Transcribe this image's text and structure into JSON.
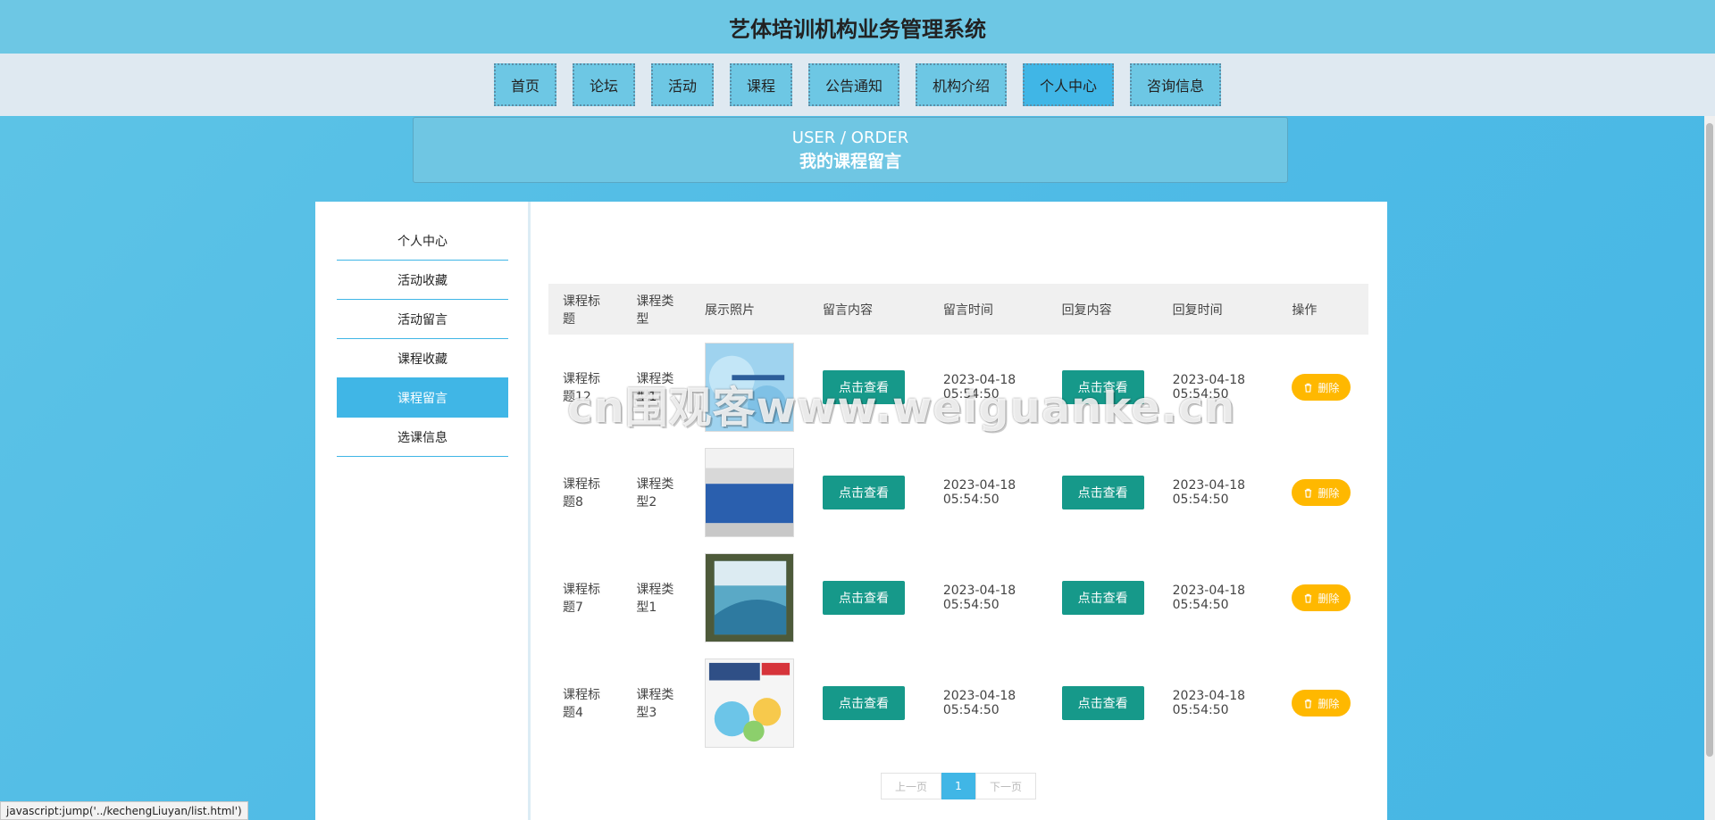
{
  "app_title": "艺体培训机构业务管理系统",
  "nav": [
    {
      "label": "首页"
    },
    {
      "label": "论坛"
    },
    {
      "label": "活动"
    },
    {
      "label": "课程"
    },
    {
      "label": "公告通知"
    },
    {
      "label": "机构介绍"
    },
    {
      "label": "个人中心",
      "active": true
    },
    {
      "label": "咨询信息"
    }
  ],
  "banner": {
    "en": "USER / ORDER",
    "zh": "我的课程留言"
  },
  "sidebar": {
    "items": [
      {
        "label": "个人中心"
      },
      {
        "label": "活动收藏"
      },
      {
        "label": "活动留言"
      },
      {
        "label": "课程收藏"
      },
      {
        "label": "课程留言",
        "active": true
      },
      {
        "label": "选课信息"
      }
    ]
  },
  "table": {
    "headers": [
      "课程标题",
      "课程类型",
      "展示照片",
      "留言内容",
      "留言时间",
      "回复内容",
      "回复时间",
      "操作"
    ],
    "rows": [
      {
        "title": "课程标题12",
        "type": "课程类型1",
        "content_btn": "点击查看",
        "time": "2023-04-18 05:54:50",
        "reply_btn": "点击查看",
        "reply_time": "2023-04-18 05:54:50",
        "delete": "删除"
      },
      {
        "title": "课程标题8",
        "type": "课程类型2",
        "content_btn": "点击查看",
        "time": "2023-04-18 05:54:50",
        "reply_btn": "点击查看",
        "reply_time": "2023-04-18 05:54:50",
        "delete": "删除"
      },
      {
        "title": "课程标题7",
        "type": "课程类型1",
        "content_btn": "点击查看",
        "time": "2023-04-18 05:54:50",
        "reply_btn": "点击查看",
        "reply_time": "2023-04-18 05:54:50",
        "delete": "删除"
      },
      {
        "title": "课程标题4",
        "type": "课程类型3",
        "content_btn": "点击查看",
        "time": "2023-04-18 05:54:50",
        "reply_btn": "点击查看",
        "reply_time": "2023-04-18 05:54:50",
        "delete": "删除"
      }
    ]
  },
  "pager": {
    "prev": "上一页",
    "current": "1",
    "next": "下一页"
  },
  "watermark": "cn围观客www.weiguanke.cn",
  "status_url": "javascript:jump('../kechengLiuyan/list.html')",
  "colors": {
    "accent": "#40b6e6",
    "view_button": "#16998a",
    "delete_button": "#ffb800"
  }
}
